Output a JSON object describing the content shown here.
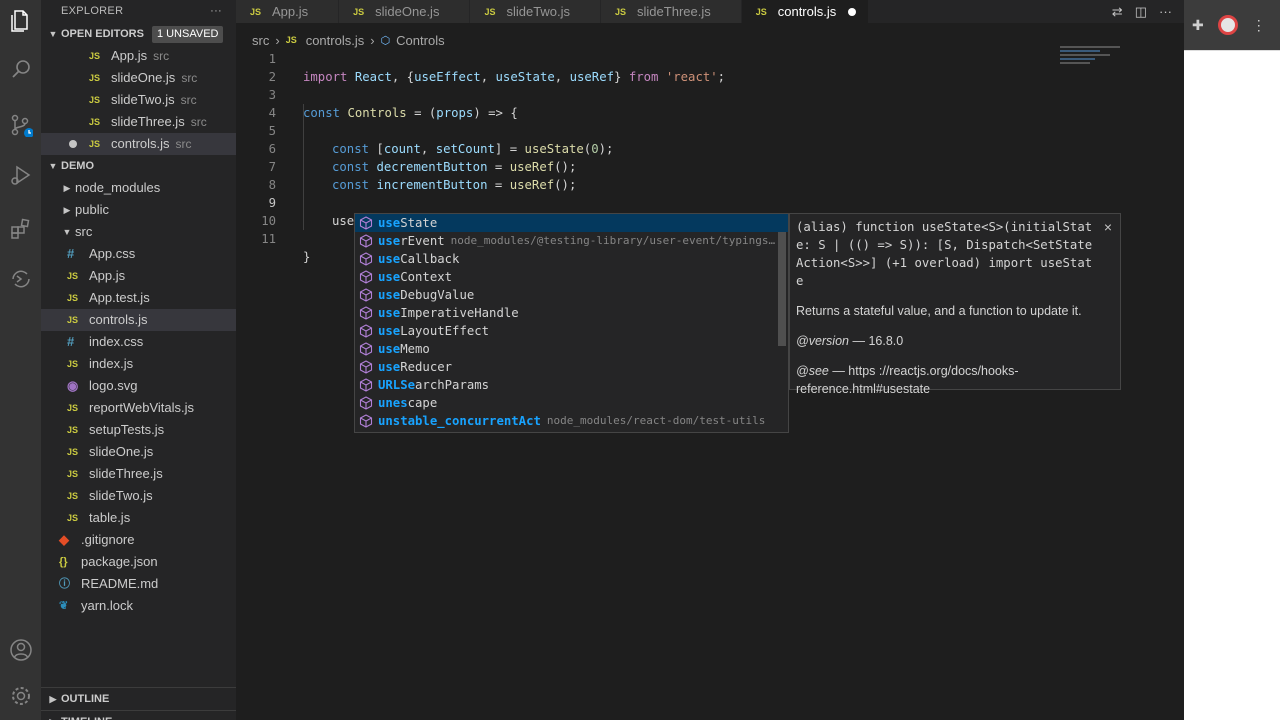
{
  "sidebar": {
    "title": "EXPLORER",
    "open_editors": {
      "label": "OPEN EDITORS",
      "badge": "1 UNSAVED",
      "items": [
        {
          "name": "App.js",
          "desc": "src",
          "type": "js"
        },
        {
          "name": "slideOne.js",
          "desc": "src",
          "type": "js"
        },
        {
          "name": "slideTwo.js",
          "desc": "src",
          "type": "js"
        },
        {
          "name": "slideThree.js",
          "desc": "src",
          "type": "js"
        },
        {
          "name": "controls.js",
          "desc": "src",
          "type": "js",
          "unsaved": true
        }
      ]
    },
    "project": {
      "label": "DEMO",
      "items": [
        {
          "name": "node_modules",
          "type": "folder"
        },
        {
          "name": "public",
          "type": "folder"
        },
        {
          "name": "src",
          "type": "folder-open"
        },
        {
          "name": "App.css",
          "type": "css"
        },
        {
          "name": "App.js",
          "type": "js"
        },
        {
          "name": "App.test.js",
          "type": "js"
        },
        {
          "name": "controls.js",
          "type": "js"
        },
        {
          "name": "index.css",
          "type": "css"
        },
        {
          "name": "index.js",
          "type": "js"
        },
        {
          "name": "logo.svg",
          "type": "svg"
        },
        {
          "name": "reportWebVitals.js",
          "type": "js"
        },
        {
          "name": "setupTests.js",
          "type": "js"
        },
        {
          "name": "slideOne.js",
          "type": "js"
        },
        {
          "name": "slideThree.js",
          "type": "js"
        },
        {
          "name": "slideTwo.js",
          "type": "js"
        },
        {
          "name": "table.js",
          "type": "js"
        },
        {
          "name": ".gitignore",
          "type": "git"
        },
        {
          "name": "package.json",
          "type": "json"
        },
        {
          "name": "README.md",
          "type": "md"
        },
        {
          "name": "yarn.lock",
          "type": "yarn"
        }
      ]
    },
    "outline_label": "OUTLINE",
    "timeline_label": "TIMELINE"
  },
  "tabs": [
    {
      "label": "App.js",
      "active": false
    },
    {
      "label": "slideOne.js",
      "active": false
    },
    {
      "label": "slideTwo.js",
      "active": false
    },
    {
      "label": "slideThree.js",
      "active": false
    },
    {
      "label": "controls.js",
      "active": true,
      "dirty": true
    }
  ],
  "breadcrumb": {
    "folder": "src",
    "file": "controls.js",
    "symbol": "Controls"
  },
  "editor": {
    "line_numbers": [
      "1",
      "2",
      "3",
      "4",
      "5",
      "6",
      "7",
      "8",
      "9",
      "10",
      "11"
    ],
    "current_line": "9",
    "l1": {
      "import": "import",
      "name": "React",
      "a": ", {",
      "e": "useEffect",
      "b": ", ",
      "s": "useState",
      "c": ", ",
      "r": "useRef",
      "d": "} ",
      "from": "from",
      "str": "'react'",
      "end": ";"
    },
    "l3": {
      "kw": "const",
      "name": "Controls",
      "eq": " = (",
      "p": "props",
      "arrow": ") => {"
    },
    "l5": {
      "kw": "const",
      "a": " [",
      "v1": "count",
      "b": ", ",
      "v2": "setCount",
      "c": "] = ",
      "fn": "useState",
      "d": "(",
      "n": "0",
      "e": ");"
    },
    "l6": {
      "kw": "const",
      "v": "decrementButton",
      "eq": " = ",
      "fn": "useRef",
      "end": "();"
    },
    "l7": {
      "kw": "const",
      "v": "incrementButton",
      "eq": " = ",
      "fn": "useRef",
      "end": "();"
    },
    "l9": "use",
    "l11": "}"
  },
  "suggest": {
    "items": [
      {
        "hl": "use",
        "rest": "State",
        "detail": "",
        "focus": true
      },
      {
        "hl": "use",
        "rest": "rEvent",
        "detail": "node_modules/@testing-library/user-event/typings…"
      },
      {
        "hl": "use",
        "rest": "Callback",
        "detail": ""
      },
      {
        "hl": "use",
        "rest": "Context",
        "detail": ""
      },
      {
        "hl": "use",
        "rest": "DebugValue",
        "detail": ""
      },
      {
        "hl": "use",
        "rest": "ImperativeHandle",
        "detail": ""
      },
      {
        "hl": "use",
        "rest": "LayoutEffect",
        "detail": ""
      },
      {
        "hl": "use",
        "rest": "Memo",
        "detail": ""
      },
      {
        "hl": "use",
        "rest": "Reducer",
        "detail": ""
      },
      {
        "hl": "URLSe",
        "rest": "archParams",
        "detail": ""
      },
      {
        "hl": "unes",
        "rest": "cape",
        "detail": ""
      },
      {
        "hl": "unstable_concurrentAct",
        "rest": "",
        "detail": "node_modules/react-dom/test-utils"
      }
    ],
    "icon_color": "#b180d7"
  },
  "details": {
    "signature": "(alias) function useState<S>(initialState: S | (() => S)): [S, Dispatch<SetStateAction<S>>] (+1 overload) import useState",
    "doc": "Returns a stateful value, and a function to update it.",
    "version_tag": "@version",
    "version_text": "— 16.8.0",
    "see_tag": "@see",
    "see_text": "— https ://reactjs.org/docs/hooks-reference.html#usestate",
    "close": "×"
  },
  "colors": {
    "accent": "#007acc",
    "selection": "#04395e"
  }
}
